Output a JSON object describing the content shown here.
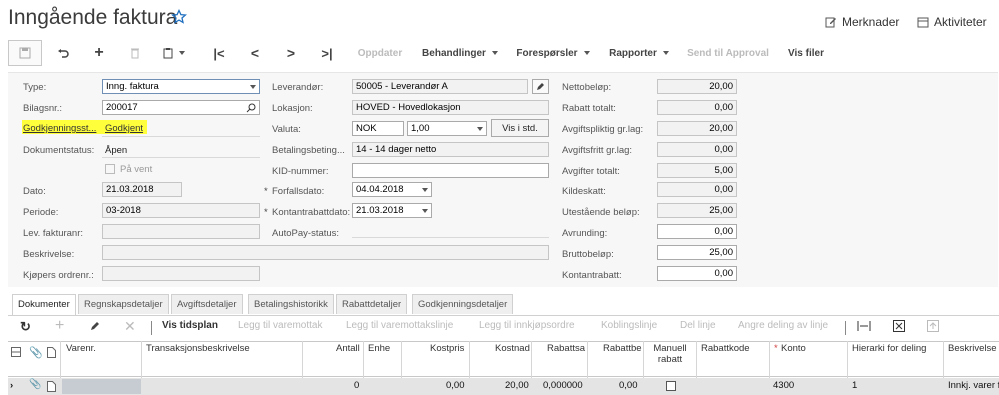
{
  "header": {
    "title": "Inngående faktura",
    "notes_label": "Merknader",
    "activities_label": "Aktiviteter"
  },
  "toolbar": {
    "update": "Oppdater",
    "actions": "Behandlinger",
    "inquiries": "Forespørsler",
    "reports": "Rapporter",
    "send_approval": "Send til Approval",
    "view_files": "Vis filer"
  },
  "form": {
    "type_label": "Type:",
    "type_value": "Inng. faktura",
    "ref_label": "Bilagsnr.:",
    "ref_value": "200017",
    "approval_label": "Godkjenningsst...",
    "approval_value": "Godkjent",
    "docstatus_label": "Dokumentstatus:",
    "docstatus_value": "Åpen",
    "onhold_label": "På vent",
    "date_label": "Dato:",
    "date_value": "21.03.2018",
    "period_label": "Periode:",
    "period_value": "03-2018",
    "vendorref_label": "Lev. fakturanr:",
    "vendorref_value": "",
    "desc_label": "Beskrivelse:",
    "desc_value": "",
    "buyer_label": "Kjøpers ordrenr.:",
    "buyer_value": "",
    "vendor_label": "Leverandør:",
    "vendor_value": "50005 - Leverandør A",
    "location_label": "Lokasjon:",
    "location_value": "HOVED - Hovedlokasjon",
    "currency_label": "Valuta:",
    "currency_value": "NOK",
    "rate_value": "1,00",
    "view_std": "Vis i std.",
    "terms_label": "Betalingsbeting...",
    "terms_value": "14 - 14 dager netto",
    "kid_label": "KID-nummer:",
    "kid_value": "",
    "due_label": "Forfallsdato:",
    "due_value": "04.04.2018",
    "cashdisc_label": "Kontantrabattdato:",
    "cashdisc_value": "21.03.2018",
    "autopay_label": "AutoPay-status:",
    "net_label": "Nettobeløp:",
    "net_value": "20,00",
    "disc_label": "Rabatt totalt:",
    "disc_value": "0,00",
    "taxable_label": "Avgiftspliktig gr.lag:",
    "taxable_value": "20,00",
    "taxfree_label": "Avgiftsfritt gr.lag:",
    "taxfree_value": "0,00",
    "taxtotal_label": "Avgifter totalt:",
    "taxtotal_value": "5,00",
    "withhold_label": "Kildeskatt:",
    "withhold_value": "0,00",
    "balance_label": "Utestående beløp:",
    "balance_value": "25,00",
    "rounding_label": "Avrunding:",
    "rounding_value": "0,00",
    "gross_label": "Bruttobeløp:",
    "gross_value": "25,00",
    "cashdiscamt_label": "Kontantrabatt:",
    "cashdiscamt_value": "0,00"
  },
  "tabs": [
    "Dokumenter",
    "Regnskapsdetaljer",
    "Avgiftsdetaljer",
    "Betalingshistorikk",
    "Rabattdetaljer",
    "Godkjenningsdetaljer"
  ],
  "grid_toolbar": {
    "schedule": "Vis tidsplan",
    "add_receipt": "Legg til varemottak",
    "add_receipt_line": "Legg til varemottakslinje",
    "add_po": "Legg til innkjøpsordre",
    "link_line": "Koblingslinje",
    "split_line": "Del linje",
    "undo_split": "Angre deling av linje"
  },
  "columns": [
    "Varenr.",
    "Transaksjonsbeskrivelse",
    "Antall",
    "Enhe",
    "Kostpris",
    "Kostnad",
    "Rabattsa",
    "Rabattbe",
    "Manuell rabatt",
    "Rabattkode",
    "Konto",
    "Hierarki for deling",
    "Beskrivelse"
  ],
  "row": {
    "qty": "0",
    "unitcost": "0,00",
    "cost": "20,00",
    "discpct": "0,000000",
    "discamt": "0,00",
    "account": "4300",
    "hierarchy": "1",
    "desc": "Innkj. varer f"
  },
  "colors": {
    "highlight": "#ffff3c",
    "accent": "#1f6fbf"
  }
}
